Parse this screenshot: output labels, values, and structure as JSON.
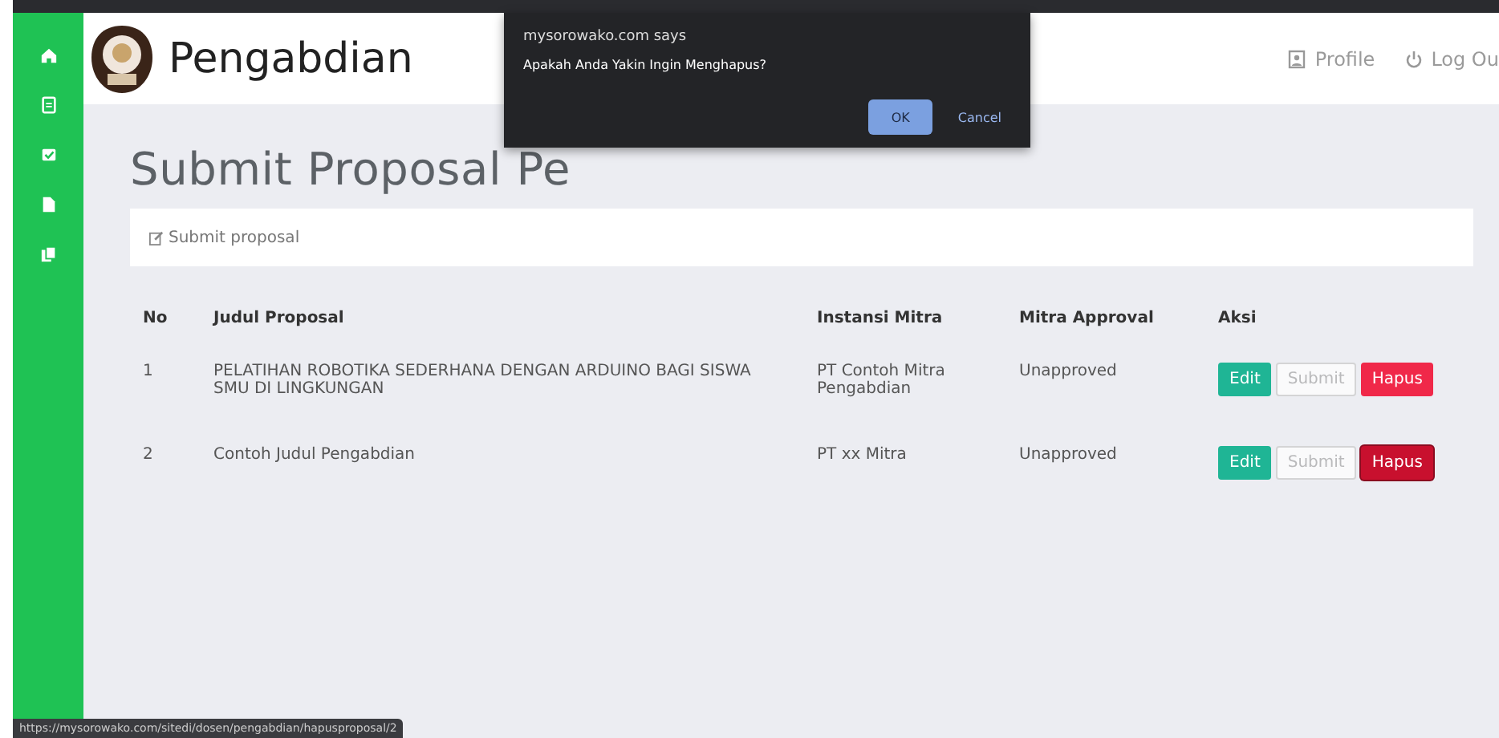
{
  "sidebar": {
    "items": [
      {
        "kind": "home",
        "selected": false
      },
      {
        "kind": "document",
        "selected": false
      },
      {
        "kind": "checkbox",
        "selected": false
      },
      {
        "kind": "file",
        "selected": false
      },
      {
        "kind": "copy",
        "selected": false
      }
    ]
  },
  "header": {
    "title": "Pengabdian",
    "links": [
      {
        "kind": "profile",
        "label": "Profile"
      },
      {
        "kind": "power",
        "label": "Log Ou"
      }
    ]
  },
  "page": {
    "title": "Submit Proposal Pe",
    "card_link": "Submit proposal"
  },
  "table": {
    "columns": [
      "No",
      "Judul Proposal",
      "Instansi Mitra",
      "Mitra Approval",
      "Aksi"
    ],
    "rows": [
      {
        "no": "1",
        "title": "PELATIHAN ROBOTIKA SEDERHANA DENGAN ARDUINO BAGI SISWA SMU DI LINGKUNGAN",
        "partner": "PT Contoh Mitra Pengabdian",
        "approval": "Unapproved",
        "actions": [
          {
            "kind": "edit",
            "label": "Edit",
            "disabled": false,
            "focused": false
          },
          {
            "kind": "submit",
            "label": "Submit",
            "disabled": true,
            "focused": false
          },
          {
            "kind": "delete",
            "label": "Hapus",
            "disabled": false,
            "focused": false
          }
        ]
      },
      {
        "no": "2",
        "title": "Contoh Judul Pengabdian",
        "partner": "PT xx Mitra",
        "approval": "Unapproved",
        "actions": [
          {
            "kind": "edit",
            "label": "Edit",
            "disabled": false,
            "focused": false
          },
          {
            "kind": "submit",
            "label": "Submit",
            "disabled": true,
            "focused": false
          },
          {
            "kind": "delete",
            "label": "Hapus",
            "disabled": false,
            "focused": true
          }
        ]
      }
    ]
  },
  "dialog": {
    "origin": "mysorowako.com says",
    "message": "Apakah Anda Yakin Ingin Menghapus?",
    "buttons": [
      {
        "kind": "primary",
        "label": "OK"
      },
      {
        "kind": "secondary",
        "label": "Cancel"
      }
    ]
  },
  "status_bar": {
    "url": "https://mysorowako.com/sitedi/dosen/pengabdian/hapusproposal/2"
  }
}
